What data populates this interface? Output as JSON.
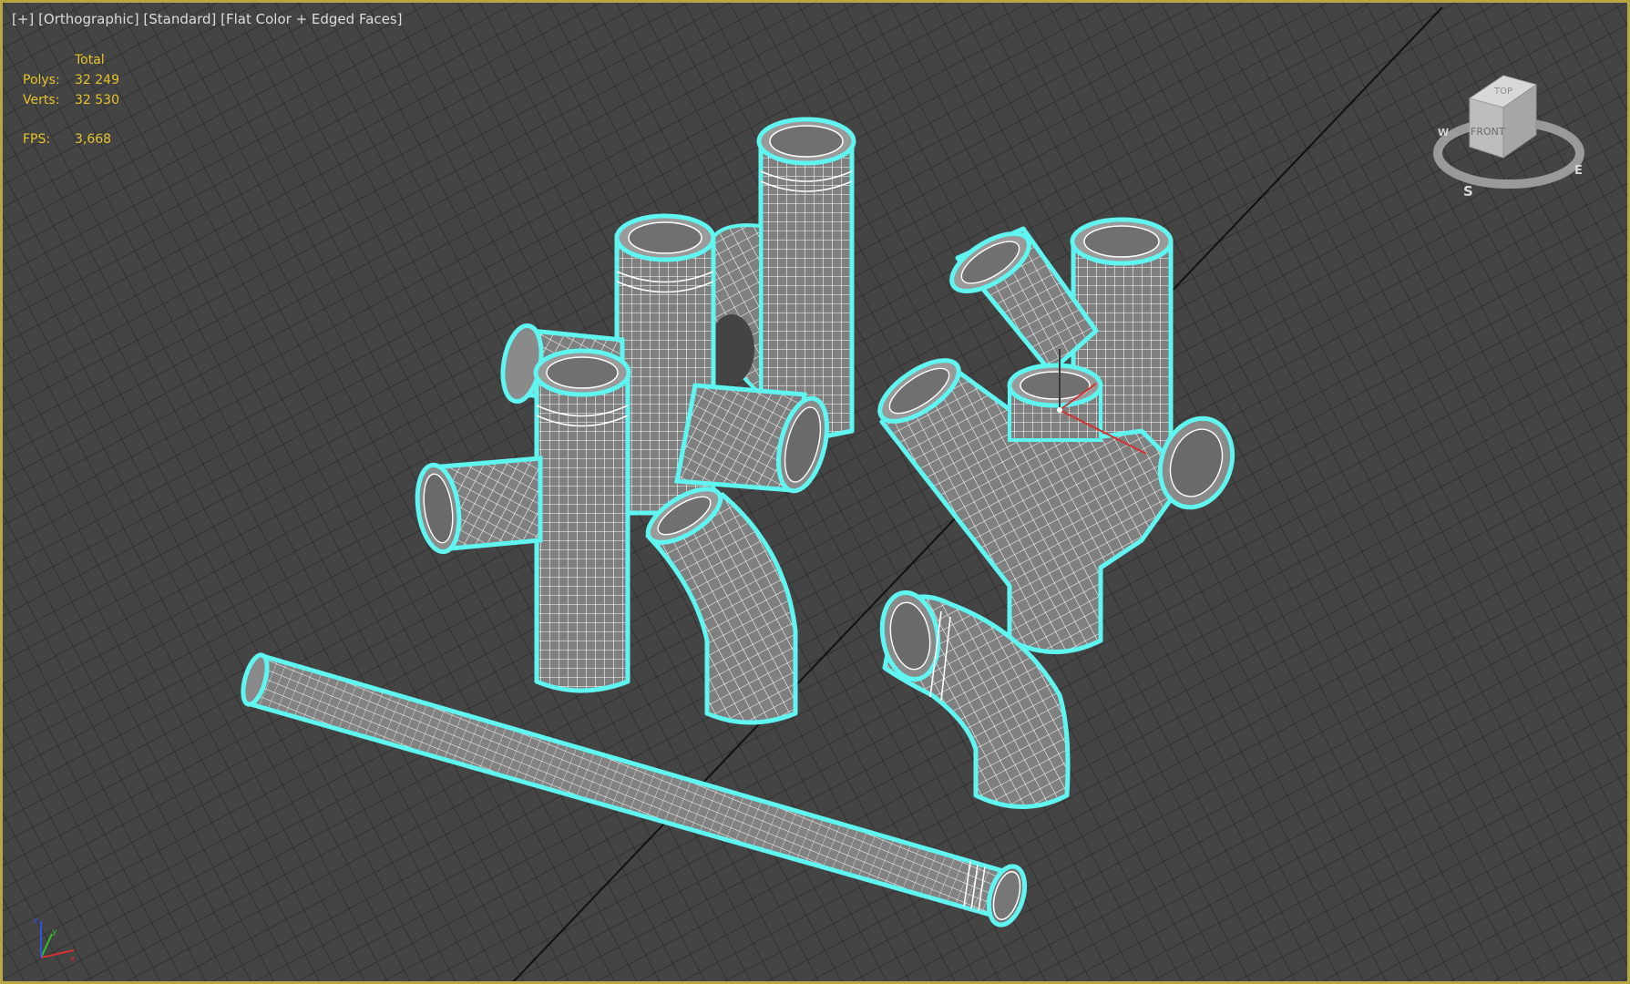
{
  "viewport_label": {
    "plus": "[+]",
    "view": "[Orthographic]",
    "style": "[Standard]",
    "shading": "[Flat Color + Edged Faces]"
  },
  "statistics": {
    "header": "Total",
    "polys_label": "Polys:",
    "polys_value": "32 249",
    "verts_label": "Verts:",
    "verts_value": "32 530",
    "fps_label": "FPS:",
    "fps_value": "3,668"
  },
  "viewcube": {
    "face_top": "TOP",
    "face_front": "FRONT",
    "compass_s": "S",
    "compass_e": "E",
    "compass_w": "W"
  },
  "axis_tripod": {
    "x": "x",
    "y": "y",
    "z": "z"
  },
  "colors": {
    "viewport_border": "#b8a642",
    "background": "#444444",
    "grid_line": "#2c2c2c",
    "mesh_fill": "#7f7f7f",
    "wire": "#ffffff",
    "selection_outline": "#5ff5f0",
    "stats_text": "#e6c32a"
  },
  "objects": [
    "pipe-straight",
    "fitting-double-cross",
    "fitting-double-y",
    "elbow-45",
    "elbow-90"
  ]
}
